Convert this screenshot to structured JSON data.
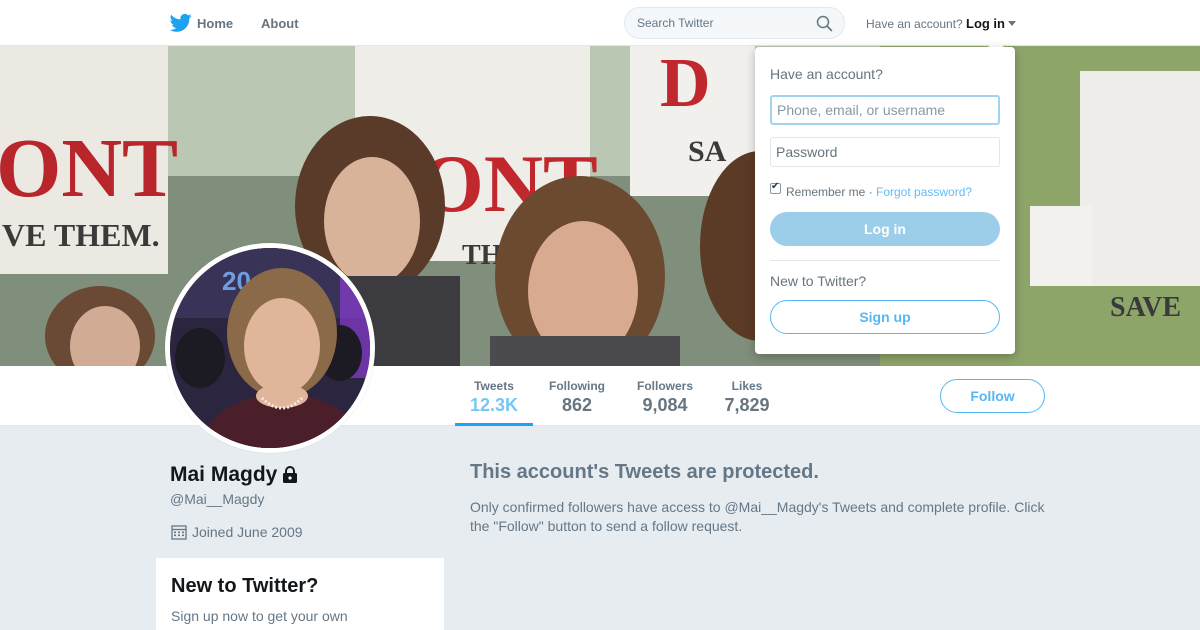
{
  "nav": {
    "home_label": "Home",
    "about_label": "About",
    "search_placeholder": "Search Twitter",
    "have_account": "Have an account?",
    "login_label": "Log in"
  },
  "banner": {
    "sign_texts": [
      "ONT",
      "VE THEM.",
      "ONT",
      "THE",
      "SA",
      "SAVE",
      "D"
    ]
  },
  "avatar": {
    "backdrop_text": "20"
  },
  "profile": {
    "name": "Mai Magdy",
    "screen_name": "@Mai__Magdy",
    "joined": "Joined June 2009"
  },
  "stats": [
    {
      "label": "Tweets",
      "value": "12.3K"
    },
    {
      "label": "Following",
      "value": "862"
    },
    {
      "label": "Followers",
      "value": "9,084"
    },
    {
      "label": "Likes",
      "value": "7,829"
    }
  ],
  "follow_label": "Follow",
  "protected": {
    "title": "This account's Tweets are protected.",
    "body": "Only confirmed followers have access to @Mai__Magdy's Tweets and complete profile. Click the \"Follow\" button to send a follow request."
  },
  "signup_card": {
    "title": "New to Twitter?",
    "text": "Sign up now to get your own personalized timeline!"
  },
  "login_dropdown": {
    "title": "Have an account?",
    "username_placeholder": "Phone, email, or username",
    "password_placeholder": "Password",
    "remember_label": "Remember me",
    "separator": "·",
    "forgot_label": "Forgot password?",
    "remember_checked": true,
    "login_button": "Log in",
    "new_label": "New to Twitter?",
    "signup_button": "Sign up"
  },
  "colors": {
    "brand": "#1da1f2",
    "background": "#e6ecf0",
    "text_secondary": "#657786"
  }
}
